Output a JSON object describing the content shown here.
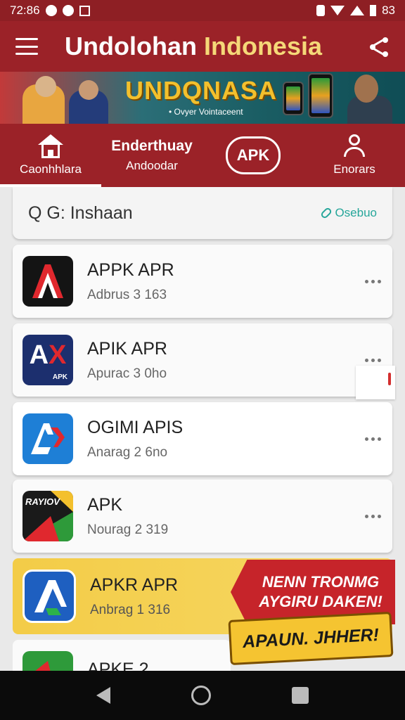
{
  "status_bar": {
    "time": "72:86",
    "battery": "83"
  },
  "app_bar": {
    "title_part1": "Undolohan ",
    "title_part2": "Indonesia",
    "accent_color": "#f5d878"
  },
  "banner": {
    "title": "UNDQNASA",
    "subtitle": "• Ovyer Vointaceent"
  },
  "tabs": [
    {
      "label": "Caonhhlara",
      "icon": "home-icon"
    },
    {
      "label_top": "Enderthuay",
      "label": "Andoodar"
    },
    {
      "label": "APK"
    },
    {
      "label": "Enorars",
      "icon": "user-icon"
    }
  ],
  "search": {
    "text": "Q G: Inshaan",
    "action": "Osebuo"
  },
  "apps": [
    {
      "name": "APPK  APR",
      "sub": "Adbrus 3 163"
    },
    {
      "name": "APIK APR",
      "sub": "Apurac 3 0ho"
    },
    {
      "name": "OGIMI APIS",
      "sub": "Anarag 2 6no"
    },
    {
      "name": "APK",
      "sub": "Nourag 2 319"
    }
  ],
  "app_icons": {
    "icon2_tag": "APK",
    "icon4_tag": "RAYIOV"
  },
  "promo": {
    "name": "APKR APR",
    "sub": "Anbrag 1 316",
    "banner_line1": "NENN TRONMG",
    "banner_line2": "AYGIRU DAKEN!",
    "cta": "APAUN. JHHER!"
  },
  "partial": {
    "name": "APKE 2"
  },
  "colors": {
    "primary": "#9b2228",
    "status_bar": "#8e1f24",
    "teal_accent": "#26a69a"
  }
}
